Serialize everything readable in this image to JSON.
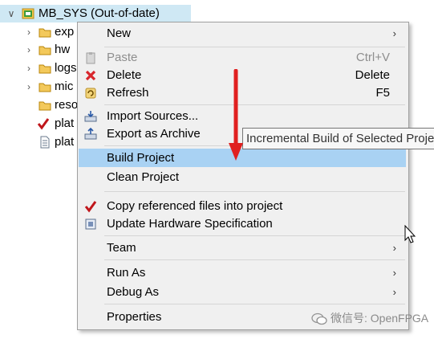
{
  "tree": {
    "root": {
      "label": "MB_SYS (Out-of-date)"
    },
    "items": [
      {
        "label": "exp",
        "icon": "folder-icon",
        "expandable": true
      },
      {
        "label": "hw",
        "icon": "folder-icon",
        "expandable": true
      },
      {
        "label": "logs",
        "icon": "folder-icon",
        "expandable": true
      },
      {
        "label": "mic",
        "icon": "folder-icon",
        "expandable": true
      },
      {
        "label": "reso",
        "icon": "folder-icon",
        "expandable": false
      },
      {
        "label": "plat",
        "icon": "check-file-icon",
        "expandable": false
      },
      {
        "label": "plat",
        "icon": "text-file-icon",
        "expandable": false
      }
    ]
  },
  "menu": {
    "new": {
      "label": "New"
    },
    "paste": {
      "label": "Paste",
      "shortcut": "Ctrl+V"
    },
    "delete": {
      "label": "Delete",
      "shortcut": "Delete"
    },
    "refresh": {
      "label": "Refresh",
      "shortcut": "F5"
    },
    "import_sources": {
      "label": "Import Sources..."
    },
    "export_archive": {
      "label": "Export as Archive"
    },
    "build_project": {
      "label": "Build Project"
    },
    "clean_project": {
      "label": "Clean Project"
    },
    "copy_referenced": {
      "label": "Copy referenced files into project"
    },
    "update_hw": {
      "label": "Update Hardware Specification"
    },
    "team": {
      "label": "Team"
    },
    "run_as": {
      "label": "Run As"
    },
    "debug_as": {
      "label": "Debug As"
    },
    "properties": {
      "label": "Properties"
    }
  },
  "tooltip": {
    "text": "Incremental Build of Selected Projects"
  },
  "watermark": {
    "text": "微信号: OpenFPGA"
  },
  "colors": {
    "selection": "#a9d2f3",
    "root_highlight": "#cfe8f4",
    "arrow": "#e02020",
    "menu_bg": "#f0f0f0"
  }
}
